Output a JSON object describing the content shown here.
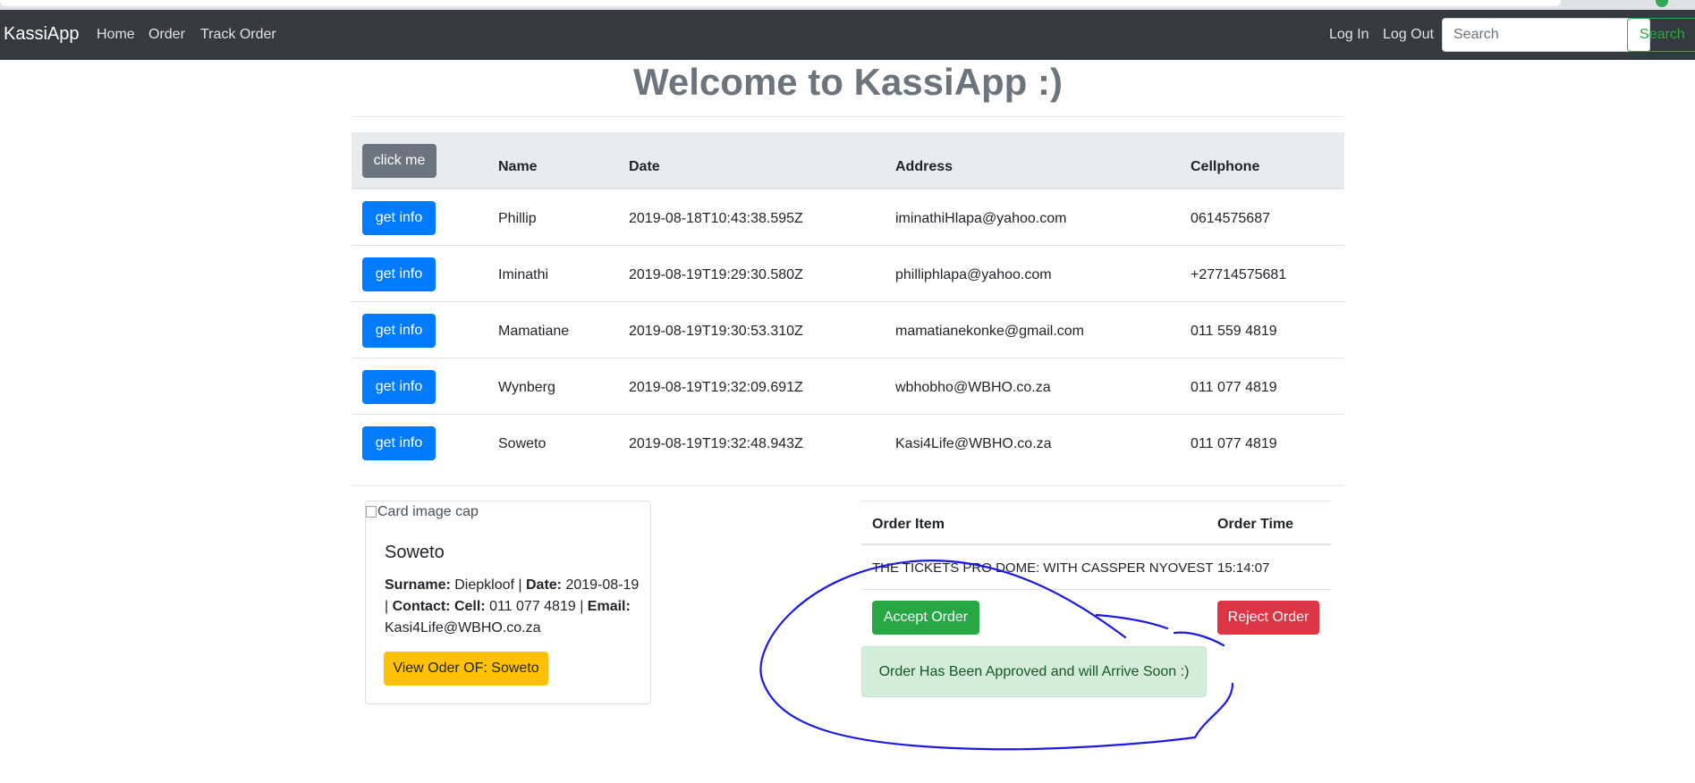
{
  "navbar": {
    "brand": "KassiApp",
    "links": [
      "Home",
      "Order",
      "Track Order"
    ],
    "right_links": [
      "Log In",
      "Log Out"
    ],
    "search_placeholder": "Search",
    "search_button": "Search"
  },
  "page": {
    "title": "Welcome to KassiApp :)"
  },
  "customers_table": {
    "header_button": "click me",
    "columns": [
      "Name",
      "Date",
      "Address",
      "Cellphone"
    ],
    "row_button": "get info",
    "rows": [
      {
        "name": "Phillip",
        "date": "2019-08-18T10:43:38.595Z",
        "address": "iminathiHlapa@yahoo.com",
        "cellphone": "0614575687"
      },
      {
        "name": "Iminathi",
        "date": "2019-08-19T19:29:30.580Z",
        "address": "philliphlapa@yahoo.com",
        "cellphone": "+27714575681"
      },
      {
        "name": "Mamatiane",
        "date": "2019-08-19T19:30:53.310Z",
        "address": "mamatianekonke@gmail.com",
        "cellphone": "011 559 4819"
      },
      {
        "name": "Wynberg",
        "date": "2019-08-19T19:32:09.691Z",
        "address": "wbhobho@WBHO.co.za",
        "cellphone": "011 077 4819"
      },
      {
        "name": "Soweto",
        "date": "2019-08-19T19:32:48.943Z",
        "address": "Kasi4Life@WBHO.co.za",
        "cellphone": "011 077 4819"
      }
    ]
  },
  "card": {
    "image_alt": "Card image cap",
    "title": "Soweto",
    "surname_label": "Surname:",
    "surname": "Diepkloof",
    "date_label": "Date:",
    "date": "2019-08-19",
    "contact_label": "Contact: Cell:",
    "cell": "011 077 4819",
    "email_label": "Email:",
    "email": "Kasi4Life@WBHO.co.za",
    "button": "View Oder OF: Soweto"
  },
  "order_table": {
    "columns": [
      "Order Item",
      "Order Time"
    ],
    "item": "THE TICKETS PRO DOME: WITH CASSPER NYOVEST",
    "time": "15:14:07",
    "accept_button": "Accept Order",
    "reject_button": "Reject Order"
  },
  "alert": {
    "message": "Order Has Been Approved and will Arrive Soon :)"
  },
  "colors": {
    "navbar": "#343a40",
    "primary": "#007bff",
    "success": "#28a745",
    "danger": "#dc3545",
    "warning": "#ffc107",
    "secondary": "#6c757d",
    "annotation": "#1a1ae0"
  }
}
